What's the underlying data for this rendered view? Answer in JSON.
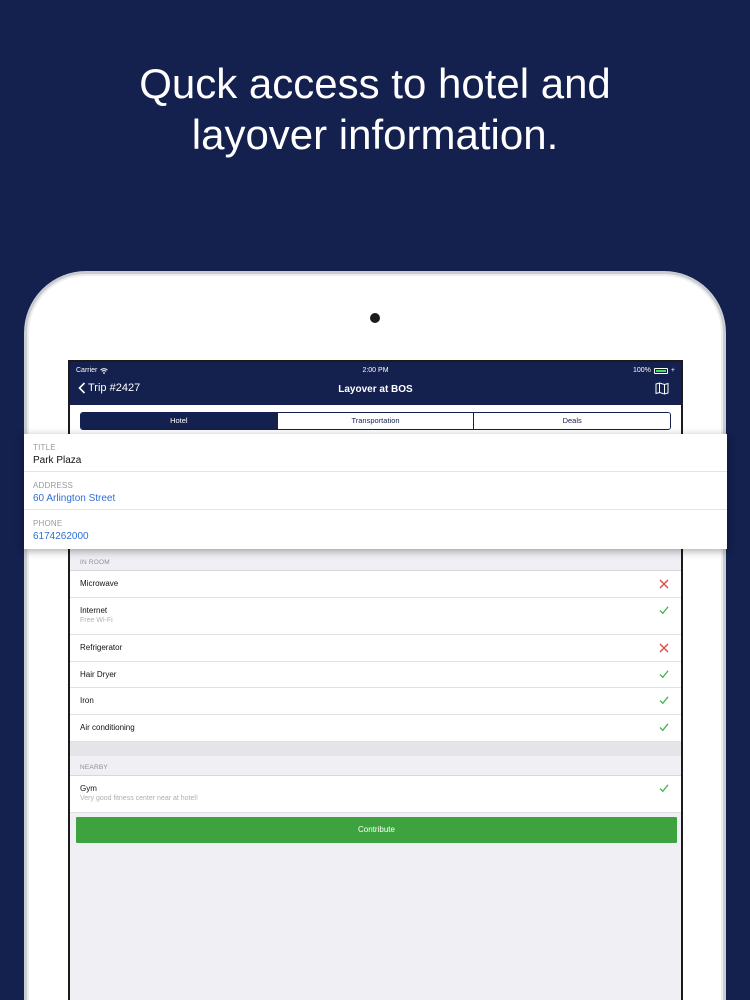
{
  "headline": {
    "line1": "Quck access to hotel and",
    "line2": "layover information."
  },
  "status_bar": {
    "carrier": "Carrier",
    "time": "2:00 PM",
    "battery": "100%"
  },
  "nav": {
    "back_label": "Trip #2427",
    "title": "Layover at BOS",
    "map_icon": "map-icon"
  },
  "tabs": [
    {
      "label": "Hotel",
      "active": true
    },
    {
      "label": "Transportation",
      "active": false
    },
    {
      "label": "Deals",
      "active": false
    }
  ],
  "hotel_card": {
    "title_label": "TITLE",
    "title_value": "Park Plaza",
    "address_label": "ADDRESS",
    "address_value": "60 Arlington Street",
    "phone_label": "PHONE",
    "phone_value": "6174262000"
  },
  "in_room": {
    "header": "IN ROOM",
    "items": [
      {
        "label": "Microwave",
        "sub": "",
        "available": false
      },
      {
        "label": "Internet",
        "sub": "Free Wi-Fi",
        "available": true
      },
      {
        "label": "Refrigerator",
        "sub": "",
        "available": false
      },
      {
        "label": "Hair Dryer",
        "sub": "",
        "available": true
      },
      {
        "label": "Iron",
        "sub": "",
        "available": true
      },
      {
        "label": "Air conditioning",
        "sub": "",
        "available": true
      }
    ]
  },
  "nearby": {
    "header": "NEARBY",
    "items": [
      {
        "label": "Gym",
        "sub": "Very good fitness center near at hotel!",
        "available": true
      }
    ]
  },
  "contribute_label": "Contribute",
  "colors": {
    "background": "#14204d",
    "accent": "#3ea33e",
    "cross": "#e0453f",
    "check": "#4caf50",
    "link": "#2e6fd6"
  }
}
